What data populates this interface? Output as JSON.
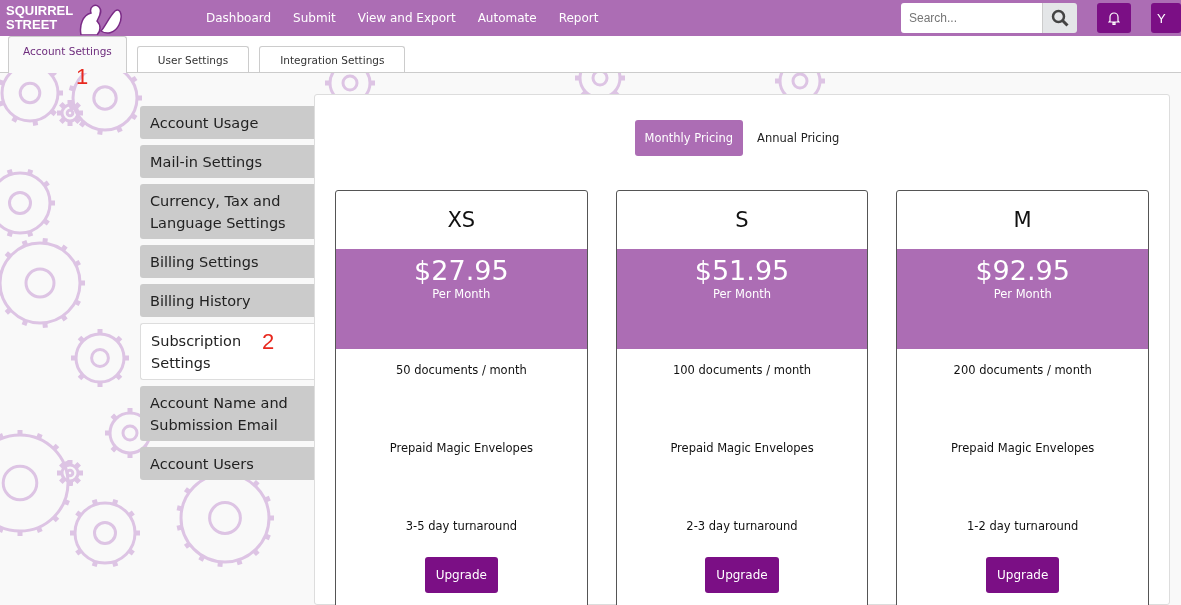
{
  "header": {
    "logo": [
      "SQUIRREL",
      "STREET"
    ],
    "nav": [
      "Dashboard",
      "Submit",
      "View and Export",
      "Automate",
      "Report"
    ],
    "search": {
      "placeholder": "Search..."
    },
    "user_button": "Y"
  },
  "tabs": [
    {
      "label": "Account Settings",
      "selected": true,
      "annotation": "1"
    },
    {
      "label": "User Settings",
      "selected": false
    },
    {
      "label": "Integration Settings",
      "selected": false
    }
  ],
  "sidebar": {
    "items": [
      {
        "label": "Account Usage",
        "selected": false
      },
      {
        "label": "Mail-in Settings",
        "selected": false
      },
      {
        "label": "Currency, Tax and Language Settings",
        "selected": false
      },
      {
        "label": "Billing Settings",
        "selected": false
      },
      {
        "label": "Billing History",
        "selected": false
      },
      {
        "label": "Subscription Settings",
        "selected": true,
        "annotation": "2"
      },
      {
        "label": "Account Name and Submission Email",
        "selected": false
      },
      {
        "label": "Account Users",
        "selected": false
      }
    ]
  },
  "pricing_toggle": [
    {
      "label": "Monthly Pricing",
      "selected": true
    },
    {
      "label": "Annual Pricing",
      "selected": false
    }
  ],
  "plans": [
    {
      "name": "XS",
      "price": "$27.95",
      "period": "Per Month",
      "features": [
        "50 documents / month",
        "Prepaid Magic Envelopes",
        "3-5 day turnaround"
      ],
      "button": "Upgrade"
    },
    {
      "name": "S",
      "price": "$51.95",
      "period": "Per Month",
      "features": [
        "100 documents / month",
        "Prepaid Magic Envelopes",
        "2-3 day turnaround"
      ],
      "button": "Upgrade"
    },
    {
      "name": "M",
      "price": "$92.95",
      "period": "Per Month",
      "features": [
        "200 documents / month",
        "Prepaid Magic Envelopes",
        "1-2 day turnaround"
      ],
      "button": "Upgrade"
    }
  ]
}
